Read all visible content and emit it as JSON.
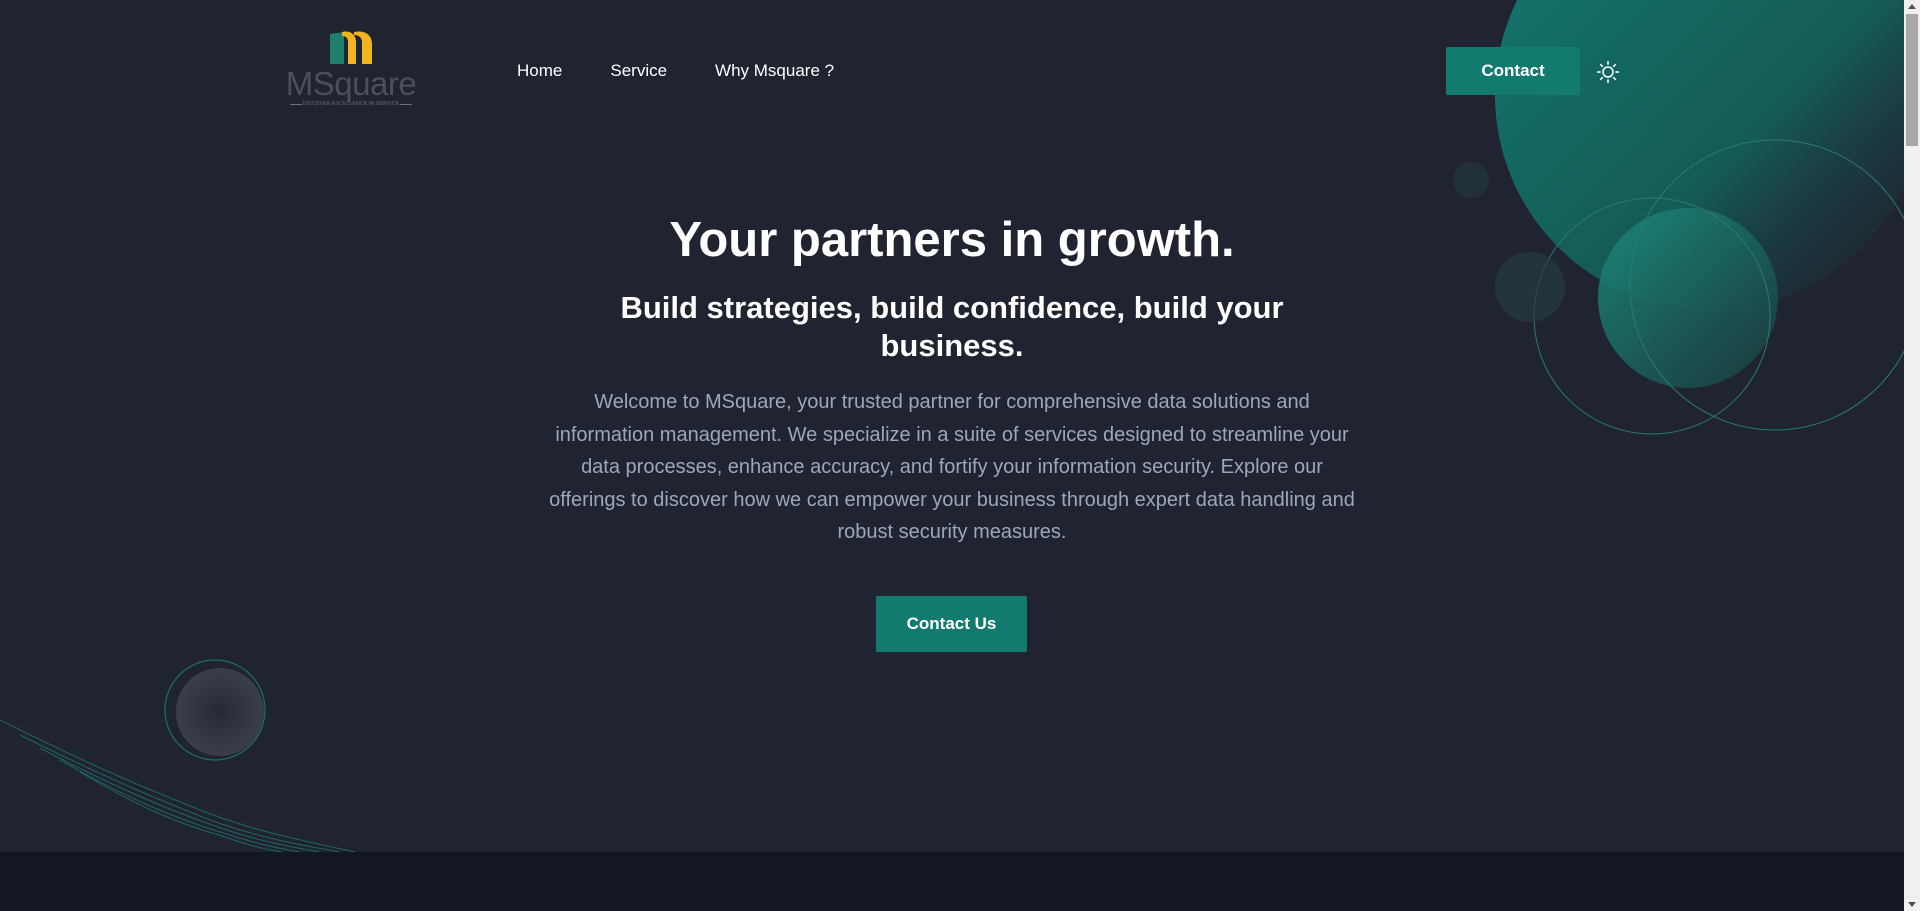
{
  "header": {
    "logo": {
      "name": "MSquare",
      "tagline": "DISCOVER EXCELLENCE IN SERVICE"
    },
    "nav": [
      {
        "label": "Home"
      },
      {
        "label": "Service"
      },
      {
        "label": "Why Msquare ?"
      }
    ],
    "contact_label": "Contact",
    "theme_icon": "sun-icon"
  },
  "hero": {
    "title": "Your partners in growth.",
    "subtitle": "Build strategies, build confidence, build your business.",
    "description": "Welcome to MSquare, your trusted partner for comprehensive data solutions and information management. We specialize in a suite of services designed to streamline your data processes, enhance accuracy, and fortify your information security. Explore our offerings to discover how we can empower your business through expert data handling and robust security measures.",
    "cta_label": "Contact Us"
  },
  "colors": {
    "background": "#1f2430",
    "accent": "#137a70",
    "logo_green": "#1e7f6e",
    "logo_yellow": "#f0b41c",
    "text_muted": "#9ca6bc",
    "footer_band": "#121722"
  }
}
